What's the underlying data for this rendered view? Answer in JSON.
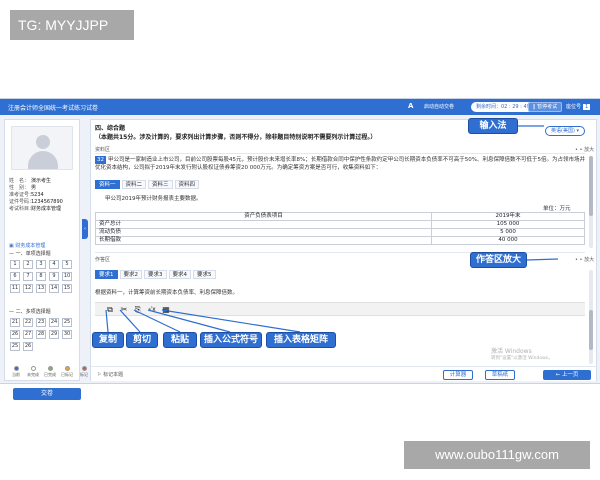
{
  "watermarks": {
    "top_left": "TG: MYYJJPP",
    "bottom_right": "www.oubo111gw.com"
  },
  "topbar": {
    "title": "注册会计师全国统一考试练习试卷",
    "font_icon": "A",
    "auto_submit": "启动自动交卷",
    "timer": "剩余时间：02 : 29 : 49",
    "pause": "‖ 暂停考试",
    "seat_label": "座位号",
    "seat_no": "1"
  },
  "candidate": {
    "rows": [
      {
        "label": "姓　名：",
        "value": "演示考生"
      },
      {
        "label": "性　别：",
        "value": "男"
      },
      {
        "label": "准考证号：",
        "value": "5234"
      },
      {
        "label": "证件号码：",
        "value": "1234567890"
      },
      {
        "label": "考试科目：",
        "value": "财务成本管理"
      }
    ],
    "subject_link": "财务成本管理",
    "section1": "一、单项选择题",
    "section2": "二、多项选择题",
    "single": [
      "1",
      "2",
      "3",
      "4",
      "5",
      "6",
      "7",
      "8",
      "9",
      "10",
      "11",
      "12",
      "13",
      "14",
      "15"
    ],
    "multi": [
      "21",
      "22",
      "23",
      "24",
      "25",
      "26",
      "27",
      "28",
      "29",
      "30",
      "25",
      "26"
    ],
    "legend": [
      "当前",
      "未完成",
      "已完成",
      "已标记",
      "标记"
    ],
    "legend_colors": [
      "#2f6fd1",
      "#ffffff",
      "#7fb36b",
      "#e9a23b",
      "#d9534f"
    ],
    "submit": "交卷",
    "collapse": "‹"
  },
  "question": {
    "title": "四、综合题",
    "desc": "（本题共15分。涉及计算的，要求列出计算步骤，否则不得分，除非题目特别说明不需要列示计算过程。）",
    "ime": "英语(美国) ▾",
    "material_label": "资料区",
    "enlarge": "• • 放大",
    "number": "32",
    "para1": "甲公司是一家制造业上市公司，目前公司股票每股45元，预计股价未来增长率8%；长期借款合同中保护性条款约定甲公司长期资本负债率不可高于50%、利息保障倍数不可低于5倍。为占领市场并优化资本结构，公司拟于2019年末发行附认股权证债券筹资20 000万元。为确定筹资方案是否可行，收集资料如下：",
    "material_tabs": [
      "资料一",
      "资料二",
      "资料三",
      "资料四"
    ],
    "sub_title": "甲公司2019年预计财务报表主要数据。",
    "unit": "单位：万元",
    "table_headers": [
      "资产负债表项目",
      "2019年末"
    ],
    "table_rows": [
      [
        "资产总计",
        "105 000"
      ],
      [
        "流动负债",
        "5 000"
      ],
      [
        "长期借款",
        "40 000"
      ]
    ],
    "answer_label": "作答区",
    "answer_tabs": [
      "要求1",
      "要求2",
      "要求3",
      "要求4",
      "要求5"
    ],
    "requirement": "根据资料一，计算筹资前长期资本负债率、利息保障倍数。",
    "tools": [
      "⧉",
      "✂",
      "⎘",
      "√x",
      "▦"
    ],
    "winmark_1": "激活 Windows",
    "winmark_2": "转到\"设置\"以激活 Windows。",
    "mark": "标记本题",
    "calc": "计算器",
    "draft": "草稿纸",
    "prev": "上一页"
  },
  "callouts": {
    "input_method": "输入法",
    "answer_enlarge": "作答区放大",
    "copy": "复制",
    "cut": "剪切",
    "paste": "粘贴",
    "formula": "插入公式符号",
    "table": "插入表格矩阵"
  }
}
